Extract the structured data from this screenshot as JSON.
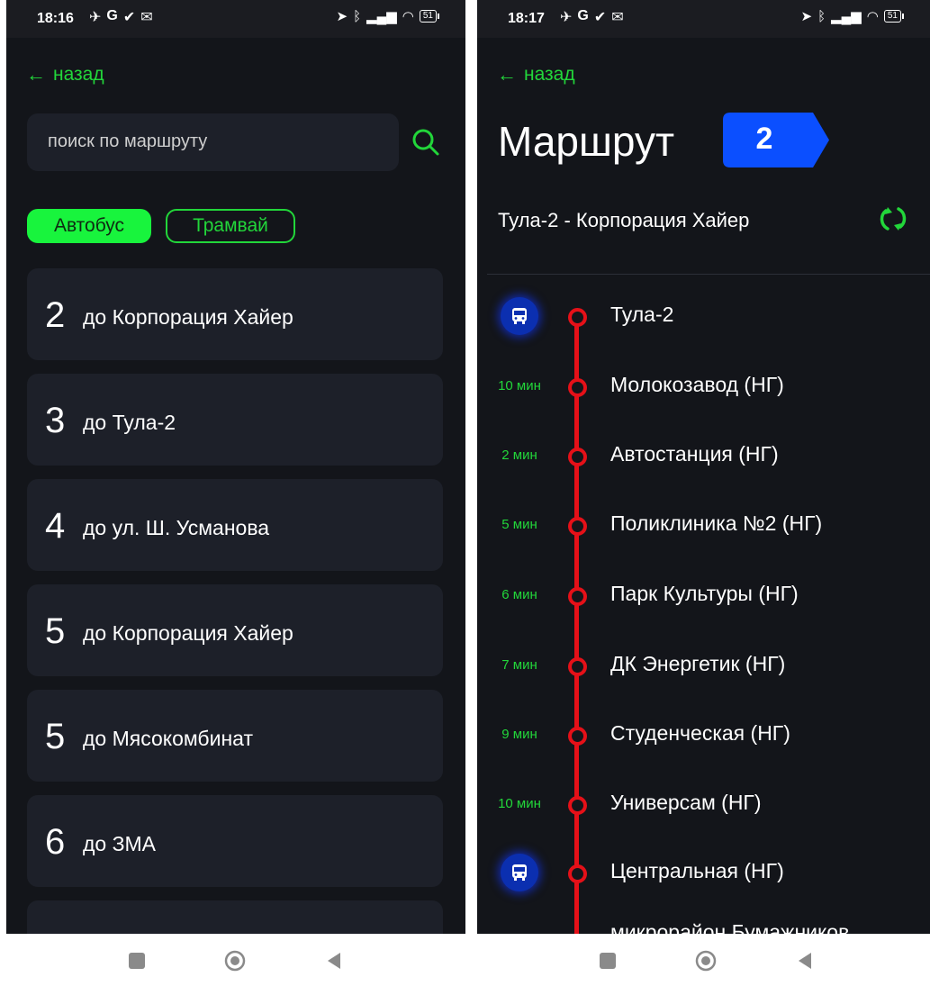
{
  "left": {
    "status": {
      "time": "18:16",
      "battery": "51"
    },
    "back_label": "назад",
    "search": {
      "placeholder": "поиск по маршруту"
    },
    "filters": [
      {
        "label": "Автобус",
        "active": true
      },
      {
        "label": "Трамвай",
        "active": false
      }
    ],
    "routes": [
      {
        "number": "2",
        "destination": "до Корпорация Хайер"
      },
      {
        "number": "3",
        "destination": "до Тула-2"
      },
      {
        "number": "4",
        "destination": "до ул. Ш. Усманова"
      },
      {
        "number": "5",
        "destination": "до Корпорация Хайер"
      },
      {
        "number": "5",
        "destination": "до Мясокомбинат"
      },
      {
        "number": "6",
        "destination": "до ЗМА"
      }
    ]
  },
  "right": {
    "status": {
      "time": "18:17",
      "battery": "51"
    },
    "back_label": "назад",
    "title": "Маршрут",
    "route_number": "2",
    "route_name": "Тула-2 - Корпорация Хайер",
    "stops": [
      {
        "time": "",
        "name": "Тула-2",
        "bus": true
      },
      {
        "time": "10 мин",
        "name": "Молокозавод (НГ)",
        "bus": false
      },
      {
        "time": "2 мин",
        "name": "Автостанция (НГ)",
        "bus": false
      },
      {
        "time": "5 мин",
        "name": "Поликлиника №2 (НГ)",
        "bus": false
      },
      {
        "time": "6 мин",
        "name": "Парк Культуры (НГ)",
        "bus": false
      },
      {
        "time": "7 мин",
        "name": "ДК Энергетик (НГ)",
        "bus": false
      },
      {
        "time": "9 мин",
        "name": "Студенческая (НГ)",
        "bus": false
      },
      {
        "time": "10 мин",
        "name": "Универсам (НГ)",
        "bus": false
      },
      {
        "time": "",
        "name": "Центральная (НГ)",
        "bus": true
      },
      {
        "time": "",
        "name": "микрорайон Бумажников",
        "bus": false
      }
    ]
  },
  "colors": {
    "accent": "#22d63a",
    "active_chip": "#18f43d",
    "route_line": "#e51018",
    "route_badge": "#0b4fff",
    "background": "#13151a",
    "card": "#1d2029"
  }
}
